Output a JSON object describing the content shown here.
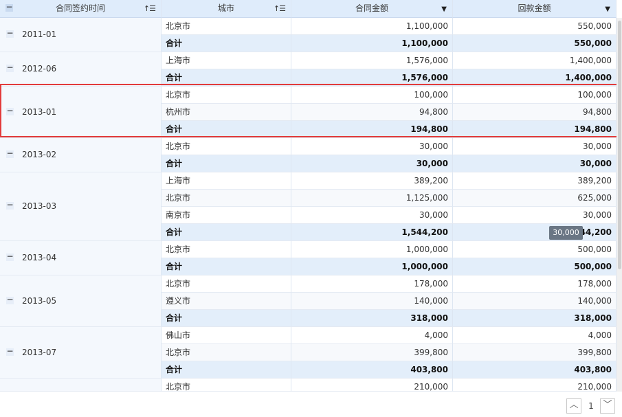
{
  "headers": {
    "date": "合同签约时间",
    "city": "城市",
    "contract_amount": "合同金额",
    "payment_amount": "回款金额",
    "sort_icon": "sort-icon",
    "dropdown_icon": "triangle-down-icon",
    "collapse_symbol": "−"
  },
  "subtotal_label": "合计",
  "groups": [
    {
      "date": "2011-01",
      "rows": [
        {
          "city": "北京市",
          "contract": "1,100,000",
          "payment": "550,000"
        }
      ],
      "total": {
        "contract": "1,100,000",
        "payment": "550,000"
      }
    },
    {
      "date": "2012-06",
      "rows": [
        {
          "city": "上海市",
          "contract": "1,576,000",
          "payment": "1,400,000"
        }
      ],
      "total": {
        "contract": "1,576,000",
        "payment": "1,400,000"
      }
    },
    {
      "date": "2013-01",
      "rows": [
        {
          "city": "北京市",
          "contract": "100,000",
          "payment": "100,000"
        },
        {
          "city": "杭州市",
          "contract": "94,800",
          "payment": "94,800"
        }
      ],
      "total": {
        "contract": "194,800",
        "payment": "194,800"
      }
    },
    {
      "date": "2013-02",
      "rows": [
        {
          "city": "北京市",
          "contract": "30,000",
          "payment": "30,000"
        }
      ],
      "total": {
        "contract": "30,000",
        "payment": "30,000"
      }
    },
    {
      "date": "2013-03",
      "rows": [
        {
          "city": "上海市",
          "contract": "389,200",
          "payment": "389,200"
        },
        {
          "city": "北京市",
          "contract": "1,125,000",
          "payment": "625,000"
        },
        {
          "city": "南京市",
          "contract": "30,000",
          "payment": "30,000"
        }
      ],
      "total": {
        "contract": "1,544,200",
        "payment": "1,044,200"
      }
    },
    {
      "date": "2013-04",
      "rows": [
        {
          "city": "北京市",
          "contract": "1,000,000",
          "payment": "500,000"
        }
      ],
      "total": {
        "contract": "1,000,000",
        "payment": "500,000"
      }
    },
    {
      "date": "2013-05",
      "rows": [
        {
          "city": "北京市",
          "contract": "178,000",
          "payment": "178,000"
        },
        {
          "city": "遵义市",
          "contract": "140,000",
          "payment": "140,000"
        }
      ],
      "total": {
        "contract": "318,000",
        "payment": "318,000"
      }
    },
    {
      "date": "2013-07",
      "rows": [
        {
          "city": "佛山市",
          "contract": "4,000",
          "payment": "4,000"
        },
        {
          "city": "北京市",
          "contract": "399,800",
          "payment": "399,800"
        }
      ],
      "total": {
        "contract": "403,800",
        "payment": "403,800"
      }
    },
    {
      "date": "",
      "rows": [
        {
          "city": "北京市",
          "contract": "210,000",
          "payment": "210,000"
        }
      ],
      "total": null
    }
  ],
  "tooltip": "30,000",
  "pagination": {
    "page": "1",
    "prev_icon": "chevron-up-icon",
    "next_icon": "chevron-down-icon"
  }
}
